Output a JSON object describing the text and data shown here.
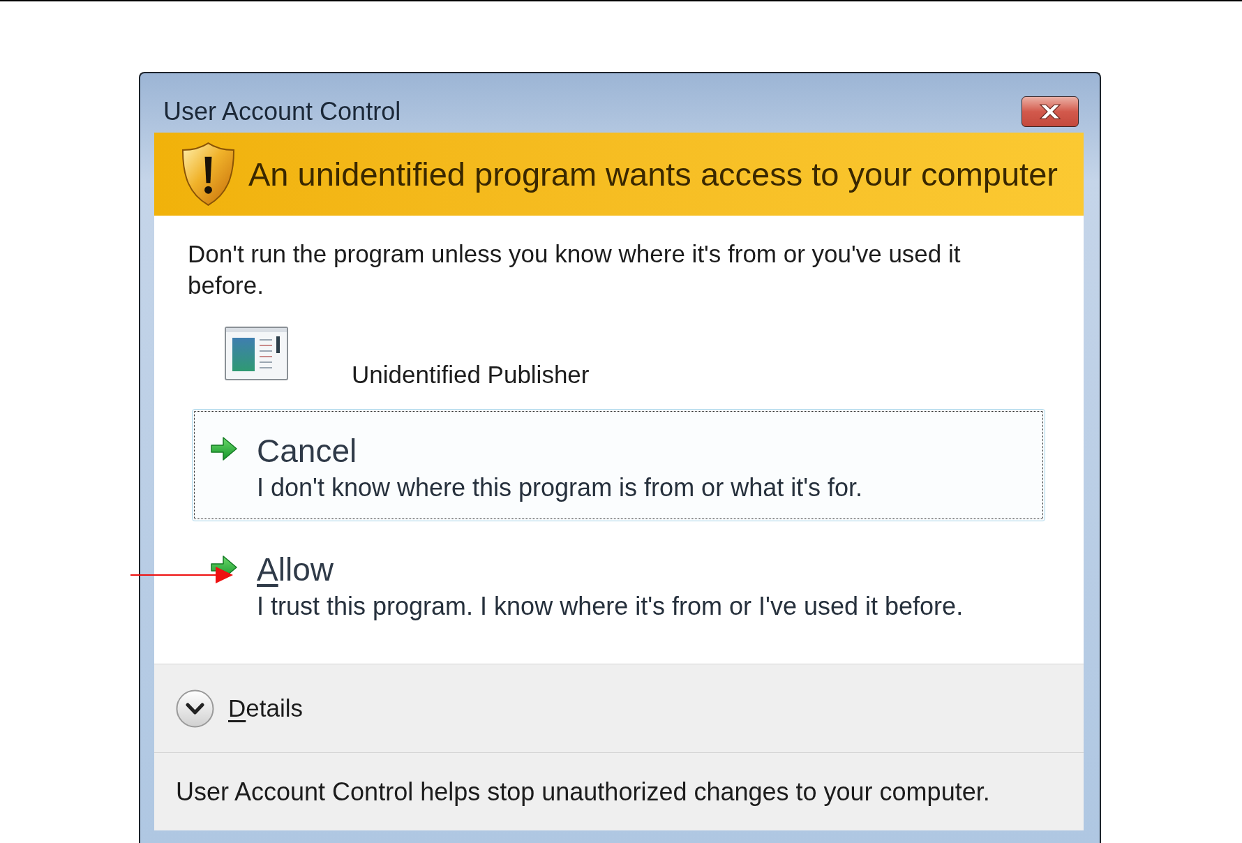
{
  "window": {
    "title": "User Account Control"
  },
  "banner": {
    "heading": "An unidentified program wants access to your computer"
  },
  "message": "Don't run the program unless you know where it's from or you've used it before.",
  "program": {
    "publisher": "Unidentified Publisher"
  },
  "options": [
    {
      "label": "Cancel",
      "description": "I don't know where this program is from or what it's for.",
      "focused": true,
      "mnemonic_underlined": false
    },
    {
      "label": "Allow",
      "description": "I trust this program. I know where it's from or I've used it before.",
      "focused": false,
      "mnemonic_underlined": true
    }
  ],
  "details": {
    "label": "Details",
    "expanded": false,
    "mnemonic_underlined": true
  },
  "footer": "User Account Control helps stop unauthorized changes to your computer."
}
